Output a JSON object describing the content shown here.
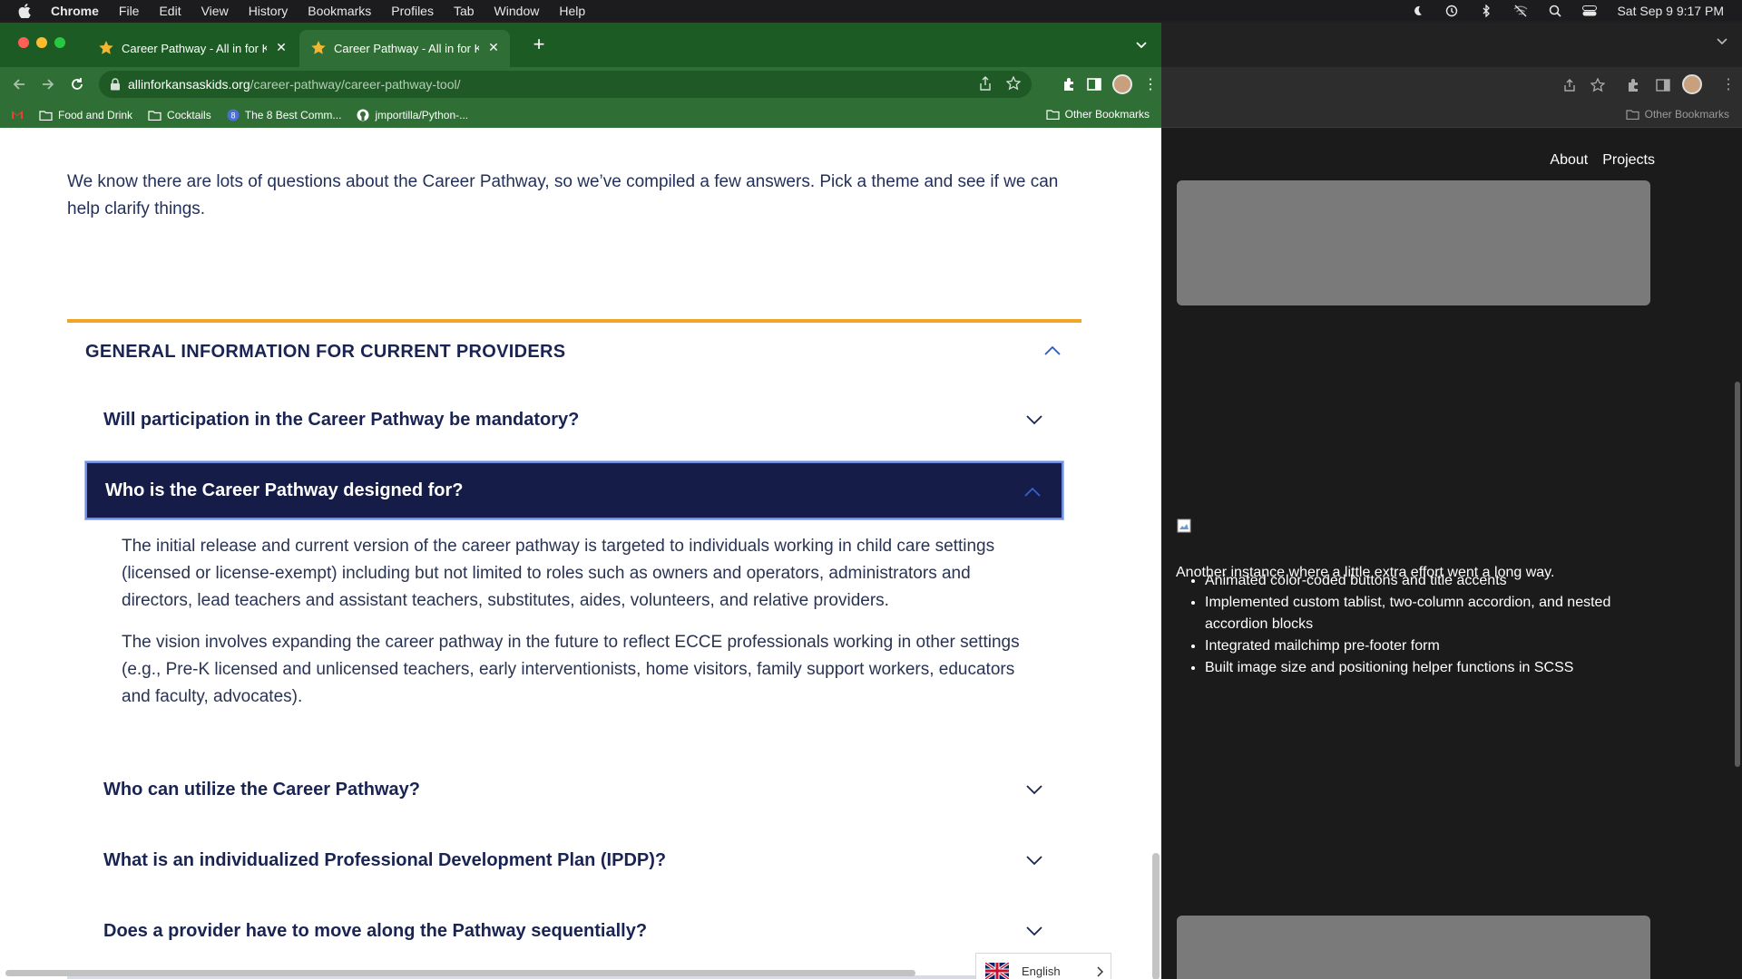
{
  "menubar": {
    "app_name": "Chrome",
    "items": [
      "File",
      "Edit",
      "View",
      "History",
      "Bookmarks",
      "Profiles",
      "Tab",
      "Window",
      "Help"
    ],
    "datetime": "Sat Sep 9  9:17 PM"
  },
  "tabs": [
    {
      "title": "Career Pathway - All in for Kansas Kids"
    },
    {
      "title": "Career Pathway - All in for Kansas Kids"
    }
  ],
  "address_bar": {
    "host": "allinforkansaskids.org",
    "path": "/career-pathway/career-pathway-tool/"
  },
  "bookmarks": [
    {
      "label": "Food and Drink"
    },
    {
      "label": "Cocktails"
    },
    {
      "label": "The 8 Best Comm..."
    },
    {
      "label": "jmportilla/Python-..."
    }
  ],
  "other_bookmarks": "Other Bookmarks",
  "page": {
    "intro": "We know there are lots of questions about the Career Pathway, so we’ve compiled a few answers. Pick a theme and see if we can help clarify things.",
    "section_title": "GENERAL INFORMATION FOR CURRENT PROVIDERS",
    "questions": [
      {
        "q": "Will participation in the Career Pathway be mandatory?"
      },
      {
        "q": "Who is the Career Pathway designed for?"
      },
      {
        "q": "Who can utilize the Career Pathway?"
      },
      {
        "q": "What is an individualized Professional Development Plan (IPDP)?"
      },
      {
        "q": "Does a provider have to move along the Pathway sequentially?"
      }
    ],
    "answer_paragraphs": [
      "The initial release and current version of the career pathway is targeted to individuals working in child care settings (licensed or license-exempt) including but not limited to roles such as owners and operators, administrators and directors, lead teachers and assistant teachers, substitutes, aides, volunteers, and relative providers.",
      "The vision involves expanding the career pathway in the future to reflect ECCE professionals working in other settings (e.g., Pre-K licensed and unlicensed teachers, early interventionists, home visitors, family support workers, educators and faculty, advocates)."
    ],
    "language": "English"
  },
  "background_window": {
    "nav": [
      "About",
      "Projects"
    ],
    "description": "Another instance where a little extra effort went a long way.",
    "bullets": [
      "Animated color-coded buttons and title accents",
      "Implemented custom tablist, two-column accordion, and nested accordion blocks",
      "Integrated mailchimp pre-footer form",
      "Built image size and positioning helper functions in SCSS"
    ],
    "other_bookmarks": "Other Bookmarks"
  },
  "colors": {
    "chrome_theme": "#2f6e34",
    "accent_line": "#f0a524",
    "navy": "#151c48"
  }
}
